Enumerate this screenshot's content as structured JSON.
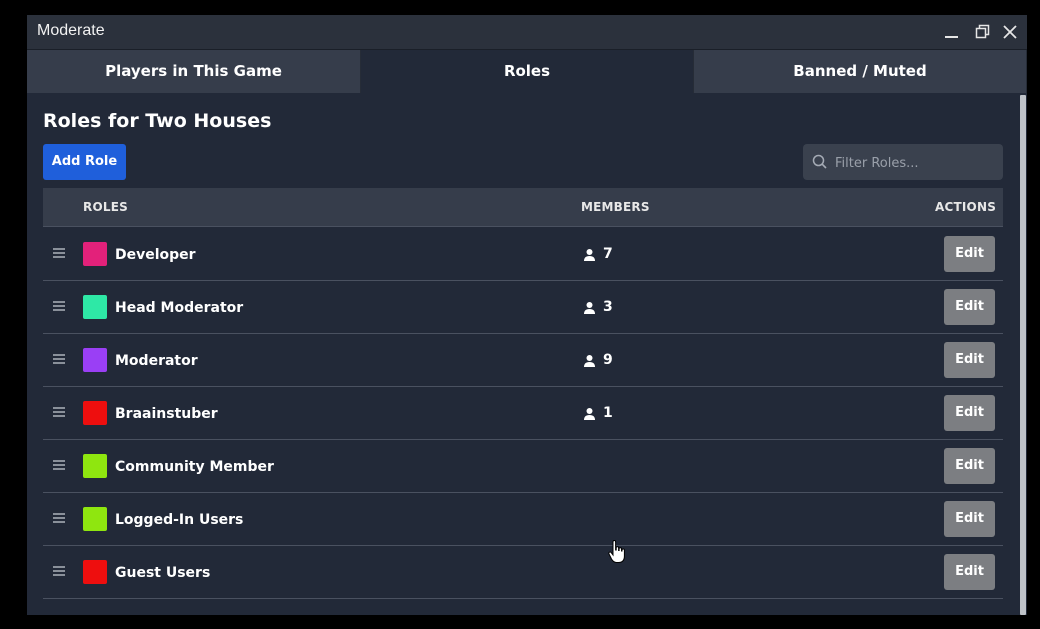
{
  "window": {
    "title": "Moderate"
  },
  "tabs": [
    {
      "label": "Players in This Game",
      "active": false
    },
    {
      "label": "Roles",
      "active": true
    },
    {
      "label": "Banned / Muted",
      "active": false
    }
  ],
  "page": {
    "heading": "Roles for Two Houses",
    "add_button": "Add Role",
    "filter_placeholder": "Filter Roles..."
  },
  "table": {
    "headers": {
      "roles": "ROLES",
      "members": "MEMBERS",
      "actions": "ACTIONS"
    },
    "rows": [
      {
        "name": "Developer",
        "color": "#e3217a",
        "members": "7",
        "action": "Edit"
      },
      {
        "name": "Head Moderator",
        "color": "#2ee8a6",
        "members": "3",
        "action": "Edit"
      },
      {
        "name": "Moderator",
        "color": "#9a3ff5",
        "members": "9",
        "action": "Edit"
      },
      {
        "name": "Braainstuber",
        "color": "#ee0e0e",
        "members": "1",
        "action": "Edit"
      },
      {
        "name": "Community Member",
        "color": "#8fe60f",
        "members": "",
        "action": "Edit"
      },
      {
        "name": "Logged-In Users",
        "color": "#8fe60f",
        "members": "",
        "action": "Edit"
      },
      {
        "name": "Guest Users",
        "color": "#ee0e0e",
        "members": "",
        "action": "Edit"
      }
    ]
  },
  "icons": {
    "minimize": "minimize-icon",
    "restore": "restore-icon",
    "close": "close-icon",
    "search": "search-icon",
    "drag": "drag-handle-icon",
    "member": "person-icon",
    "cursor": "hand-cursor-icon"
  }
}
